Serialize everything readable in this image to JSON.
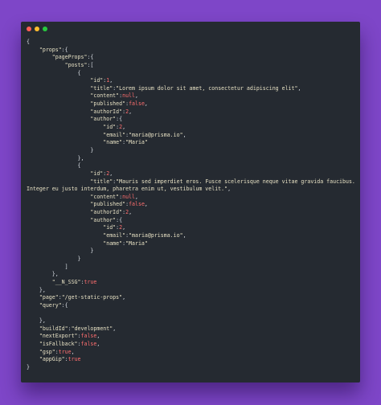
{
  "window": {
    "controls": [
      {
        "name": "close",
        "color": "#ff5f56"
      },
      {
        "name": "minimize",
        "color": "#ffbd2e"
      },
      {
        "name": "maximize",
        "color": "#27c93f"
      }
    ]
  },
  "colors": {
    "background": "#7e46c8",
    "panel": "#252a31",
    "string": "#e7e1c4",
    "literal": "#ff6f6f",
    "punct": "#d7dce2"
  },
  "lines": [
    [
      {
        "t": "{",
        "c": "p"
      }
    ],
    [
      {
        "t": "    \"props\"",
        "c": "k"
      },
      {
        "t": ":{",
        "c": "p"
      }
    ],
    [
      {
        "t": "        \"pageProps\"",
        "c": "k"
      },
      {
        "t": ":{",
        "c": "p"
      }
    ],
    [
      {
        "t": "            \"posts\"",
        "c": "k"
      },
      {
        "t": ":[",
        "c": "p"
      }
    ],
    [
      {
        "t": "                {",
        "c": "p"
      }
    ],
    [
      {
        "t": "                    \"id\"",
        "c": "k"
      },
      {
        "t": ":",
        "c": "p"
      },
      {
        "t": "1",
        "c": "n"
      },
      {
        "t": ",",
        "c": "p"
      }
    ],
    [
      {
        "t": "                    \"title\"",
        "c": "k"
      },
      {
        "t": ":",
        "c": "p"
      },
      {
        "t": "\"Lorem ipsum dolor sit amet, consectetur adipiscing elit\"",
        "c": "s"
      },
      {
        "t": ",",
        "c": "p"
      }
    ],
    [
      {
        "t": "                    \"content\"",
        "c": "k"
      },
      {
        "t": ":",
        "c": "p"
      },
      {
        "t": "null",
        "c": "b"
      },
      {
        "t": ",",
        "c": "p"
      }
    ],
    [
      {
        "t": "                    \"published\"",
        "c": "k"
      },
      {
        "t": ":",
        "c": "p"
      },
      {
        "t": "false",
        "c": "b"
      },
      {
        "t": ",",
        "c": "p"
      }
    ],
    [
      {
        "t": "                    \"authorId\"",
        "c": "k"
      },
      {
        "t": ":",
        "c": "p"
      },
      {
        "t": "2",
        "c": "n"
      },
      {
        "t": ",",
        "c": "p"
      }
    ],
    [
      {
        "t": "                    \"author\"",
        "c": "k"
      },
      {
        "t": ":{",
        "c": "p"
      }
    ],
    [
      {
        "t": "                        \"id\"",
        "c": "k"
      },
      {
        "t": ":",
        "c": "p"
      },
      {
        "t": "2",
        "c": "n"
      },
      {
        "t": ",",
        "c": "p"
      }
    ],
    [
      {
        "t": "                        \"email\"",
        "c": "k"
      },
      {
        "t": ":",
        "c": "p"
      },
      {
        "t": "\"maria@prisma.io\"",
        "c": "s"
      },
      {
        "t": ",",
        "c": "p"
      }
    ],
    [
      {
        "t": "                        \"name\"",
        "c": "k"
      },
      {
        "t": ":",
        "c": "p"
      },
      {
        "t": "\"Maria\"",
        "c": "s"
      }
    ],
    [
      {
        "t": "                    }",
        "c": "p"
      }
    ],
    [
      {
        "t": "                },",
        "c": "p"
      }
    ],
    [
      {
        "t": "                {",
        "c": "p"
      }
    ],
    [
      {
        "t": "                    \"id\"",
        "c": "k"
      },
      {
        "t": ":",
        "c": "p"
      },
      {
        "t": "2",
        "c": "n"
      },
      {
        "t": ",",
        "c": "p"
      }
    ],
    [
      {
        "t": "                    \"title\"",
        "c": "k"
      },
      {
        "t": ":",
        "c": "p"
      },
      {
        "t": "\"Mauris sed imperdiet eros. Fusce scelerisque neque vitae gravida faucibus.",
        "c": "s"
      }
    ],
    [
      {
        "t": "Integer eu justo interdum, pharetra enim ut, vestibulum velit.\"",
        "c": "s"
      },
      {
        "t": ",",
        "c": "p"
      }
    ],
    [
      {
        "t": "                    \"content\"",
        "c": "k"
      },
      {
        "t": ":",
        "c": "p"
      },
      {
        "t": "null",
        "c": "b"
      },
      {
        "t": ",",
        "c": "p"
      }
    ],
    [
      {
        "t": "                    \"published\"",
        "c": "k"
      },
      {
        "t": ":",
        "c": "p"
      },
      {
        "t": "false",
        "c": "b"
      },
      {
        "t": ",",
        "c": "p"
      }
    ],
    [
      {
        "t": "                    \"authorId\"",
        "c": "k"
      },
      {
        "t": ":",
        "c": "p"
      },
      {
        "t": "2",
        "c": "n"
      },
      {
        "t": ",",
        "c": "p"
      }
    ],
    [
      {
        "t": "                    \"author\"",
        "c": "k"
      },
      {
        "t": ":{",
        "c": "p"
      }
    ],
    [
      {
        "t": "                        \"id\"",
        "c": "k"
      },
      {
        "t": ":",
        "c": "p"
      },
      {
        "t": "2",
        "c": "n"
      },
      {
        "t": ",",
        "c": "p"
      }
    ],
    [
      {
        "t": "                        \"email\"",
        "c": "k"
      },
      {
        "t": ":",
        "c": "p"
      },
      {
        "t": "\"maria@prisma.io\"",
        "c": "s"
      },
      {
        "t": ",",
        "c": "p"
      }
    ],
    [
      {
        "t": "                        \"name\"",
        "c": "k"
      },
      {
        "t": ":",
        "c": "p"
      },
      {
        "t": "\"Maria\"",
        "c": "s"
      }
    ],
    [
      {
        "t": "                    }",
        "c": "p"
      }
    ],
    [
      {
        "t": "                }",
        "c": "p"
      }
    ],
    [
      {
        "t": "            ]",
        "c": "p"
      }
    ],
    [
      {
        "t": "        },",
        "c": "p"
      }
    ],
    [
      {
        "t": "        \"__N_SSG\"",
        "c": "k"
      },
      {
        "t": ":",
        "c": "p"
      },
      {
        "t": "true",
        "c": "b"
      }
    ],
    [
      {
        "t": "    },",
        "c": "p"
      }
    ],
    [
      {
        "t": "    \"page\"",
        "c": "k"
      },
      {
        "t": ":",
        "c": "p"
      },
      {
        "t": "\"/get-static-props\"",
        "c": "s"
      },
      {
        "t": ",",
        "c": "p"
      }
    ],
    [
      {
        "t": "    \"query\"",
        "c": "k"
      },
      {
        "t": ":{",
        "c": "p"
      }
    ],
    [
      {
        "t": "",
        "c": "p"
      }
    ],
    [
      {
        "t": "    },",
        "c": "p"
      }
    ],
    [
      {
        "t": "    \"buildId\"",
        "c": "k"
      },
      {
        "t": ":",
        "c": "p"
      },
      {
        "t": "\"development\"",
        "c": "s"
      },
      {
        "t": ",",
        "c": "p"
      }
    ],
    [
      {
        "t": "    \"nextExport\"",
        "c": "k"
      },
      {
        "t": ":",
        "c": "p"
      },
      {
        "t": "false",
        "c": "b"
      },
      {
        "t": ",",
        "c": "p"
      }
    ],
    [
      {
        "t": "    \"isFallback\"",
        "c": "k"
      },
      {
        "t": ":",
        "c": "p"
      },
      {
        "t": "false",
        "c": "b"
      },
      {
        "t": ",",
        "c": "p"
      }
    ],
    [
      {
        "t": "    \"gsp\"",
        "c": "k"
      },
      {
        "t": ":",
        "c": "p"
      },
      {
        "t": "true",
        "c": "b"
      },
      {
        "t": ",",
        "c": "p"
      }
    ],
    [
      {
        "t": "    \"appGip\"",
        "c": "k"
      },
      {
        "t": ":",
        "c": "p"
      },
      {
        "t": "true",
        "c": "b"
      }
    ],
    [
      {
        "t": "}",
        "c": "p"
      }
    ]
  ]
}
